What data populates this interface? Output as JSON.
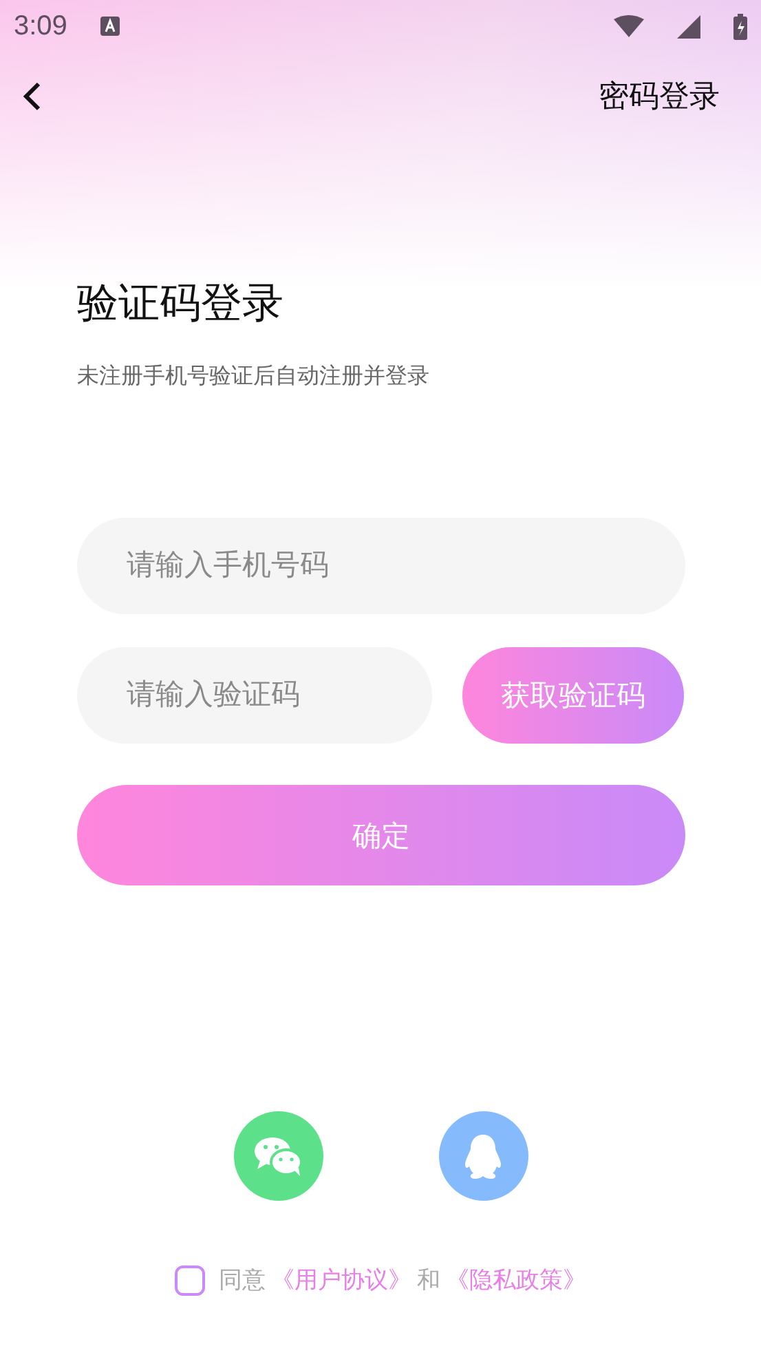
{
  "status_bar": {
    "time": "3:09"
  },
  "nav": {
    "right_link": "密码登录"
  },
  "title": "验证码登录",
  "subtitle": "未注册手机号验证后自动注册并登录",
  "phone_field": {
    "placeholder": "请输入手机号码"
  },
  "code_field": {
    "placeholder": "请输入验证码"
  },
  "get_code_button": "获取验证码",
  "confirm_button": "确定",
  "social_logins": [
    {
      "kind": "wechat"
    },
    {
      "kind": "qq"
    }
  ],
  "agreement": {
    "checked": false,
    "prefix": "同意",
    "link_1": "《用户协议》",
    "joiner": "和",
    "link_2": "《隐私政策》"
  }
}
